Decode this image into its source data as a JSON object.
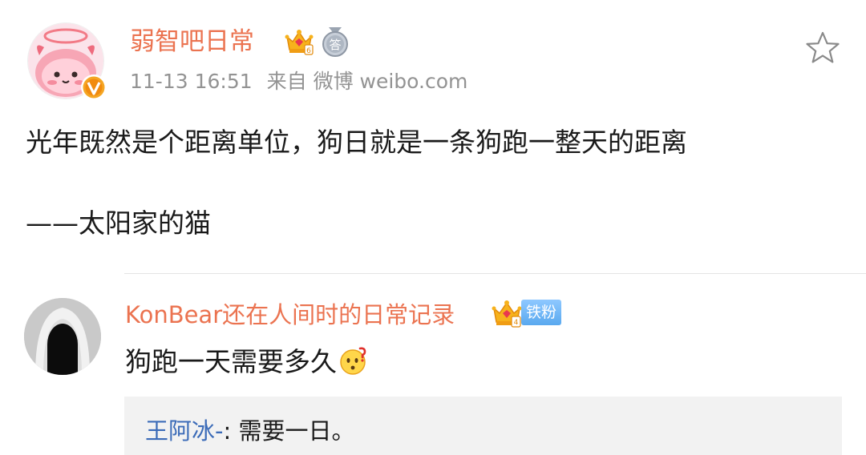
{
  "post": {
    "username": "弱智吧日常",
    "time": "11-13 16:51",
    "source": "来自 微博 weibo.com",
    "text": "光年既然是个距离单位，狗日就是一条狗跑一整天的距离",
    "signature": "——太阳家的猫",
    "badge_medal_char": "答"
  },
  "comment": {
    "username": "KonBear还在人间时的日常记录",
    "fan_badge": "铁粉",
    "text": "狗跑一天需要多久"
  },
  "reply": {
    "username": "王阿冰-",
    "separator": ": ",
    "text": "需要一日。"
  },
  "icons": {
    "star": "star-outline-icon",
    "verified": "verified-v-icon",
    "crown": "crown-badge-icon",
    "medal": "medal-badge-icon",
    "emoji": "question-face-emoji"
  },
  "colors": {
    "username": "#eb7350",
    "reply_user": "#3b6bb8",
    "meta": "#939393",
    "text": "#1a1a1a",
    "reply_bg": "#f2f2f2"
  }
}
